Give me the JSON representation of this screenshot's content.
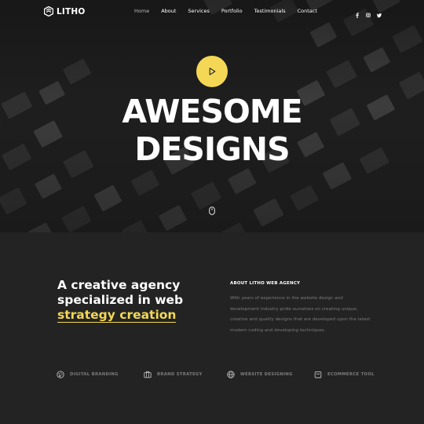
{
  "brand": {
    "name": "LITHO"
  },
  "nav": {
    "items": [
      {
        "label": "Home",
        "active": true
      },
      {
        "label": "About"
      },
      {
        "label": "Services"
      },
      {
        "label": "Portfolio"
      },
      {
        "label": "Testimonials"
      },
      {
        "label": "Contact"
      }
    ],
    "socials": [
      "facebook-icon",
      "instagram-icon",
      "twitter-icon"
    ]
  },
  "hero": {
    "headline_line1": "AWESOME",
    "headline_line2": "DESIGNS",
    "play_icon": "play-icon",
    "scroll_icon": "mouse-icon"
  },
  "about": {
    "title_line1": "A creative agency",
    "title_line2": "specialized in web",
    "title_highlight": "strategy creation",
    "heading": "ABOUT LITHO WEB AGENCY",
    "text": "With years of experience in the website design and development industry pride ourselves on creating unique, creative and quality designs that are developed upon the latest modern coding and developing techniques."
  },
  "features": [
    {
      "label": "DIGITAL BRANDING",
      "icon": "palette-icon"
    },
    {
      "label": "BRAND STRATEGY",
      "icon": "briefcase-icon"
    },
    {
      "label": "WEBSITE DESIGNING",
      "icon": "globe-icon"
    },
    {
      "label": "ECOMMERCE TOOL",
      "icon": "shopping-bag-icon"
    }
  ],
  "colors": {
    "accent": "#f4d855",
    "background": "#232323"
  }
}
